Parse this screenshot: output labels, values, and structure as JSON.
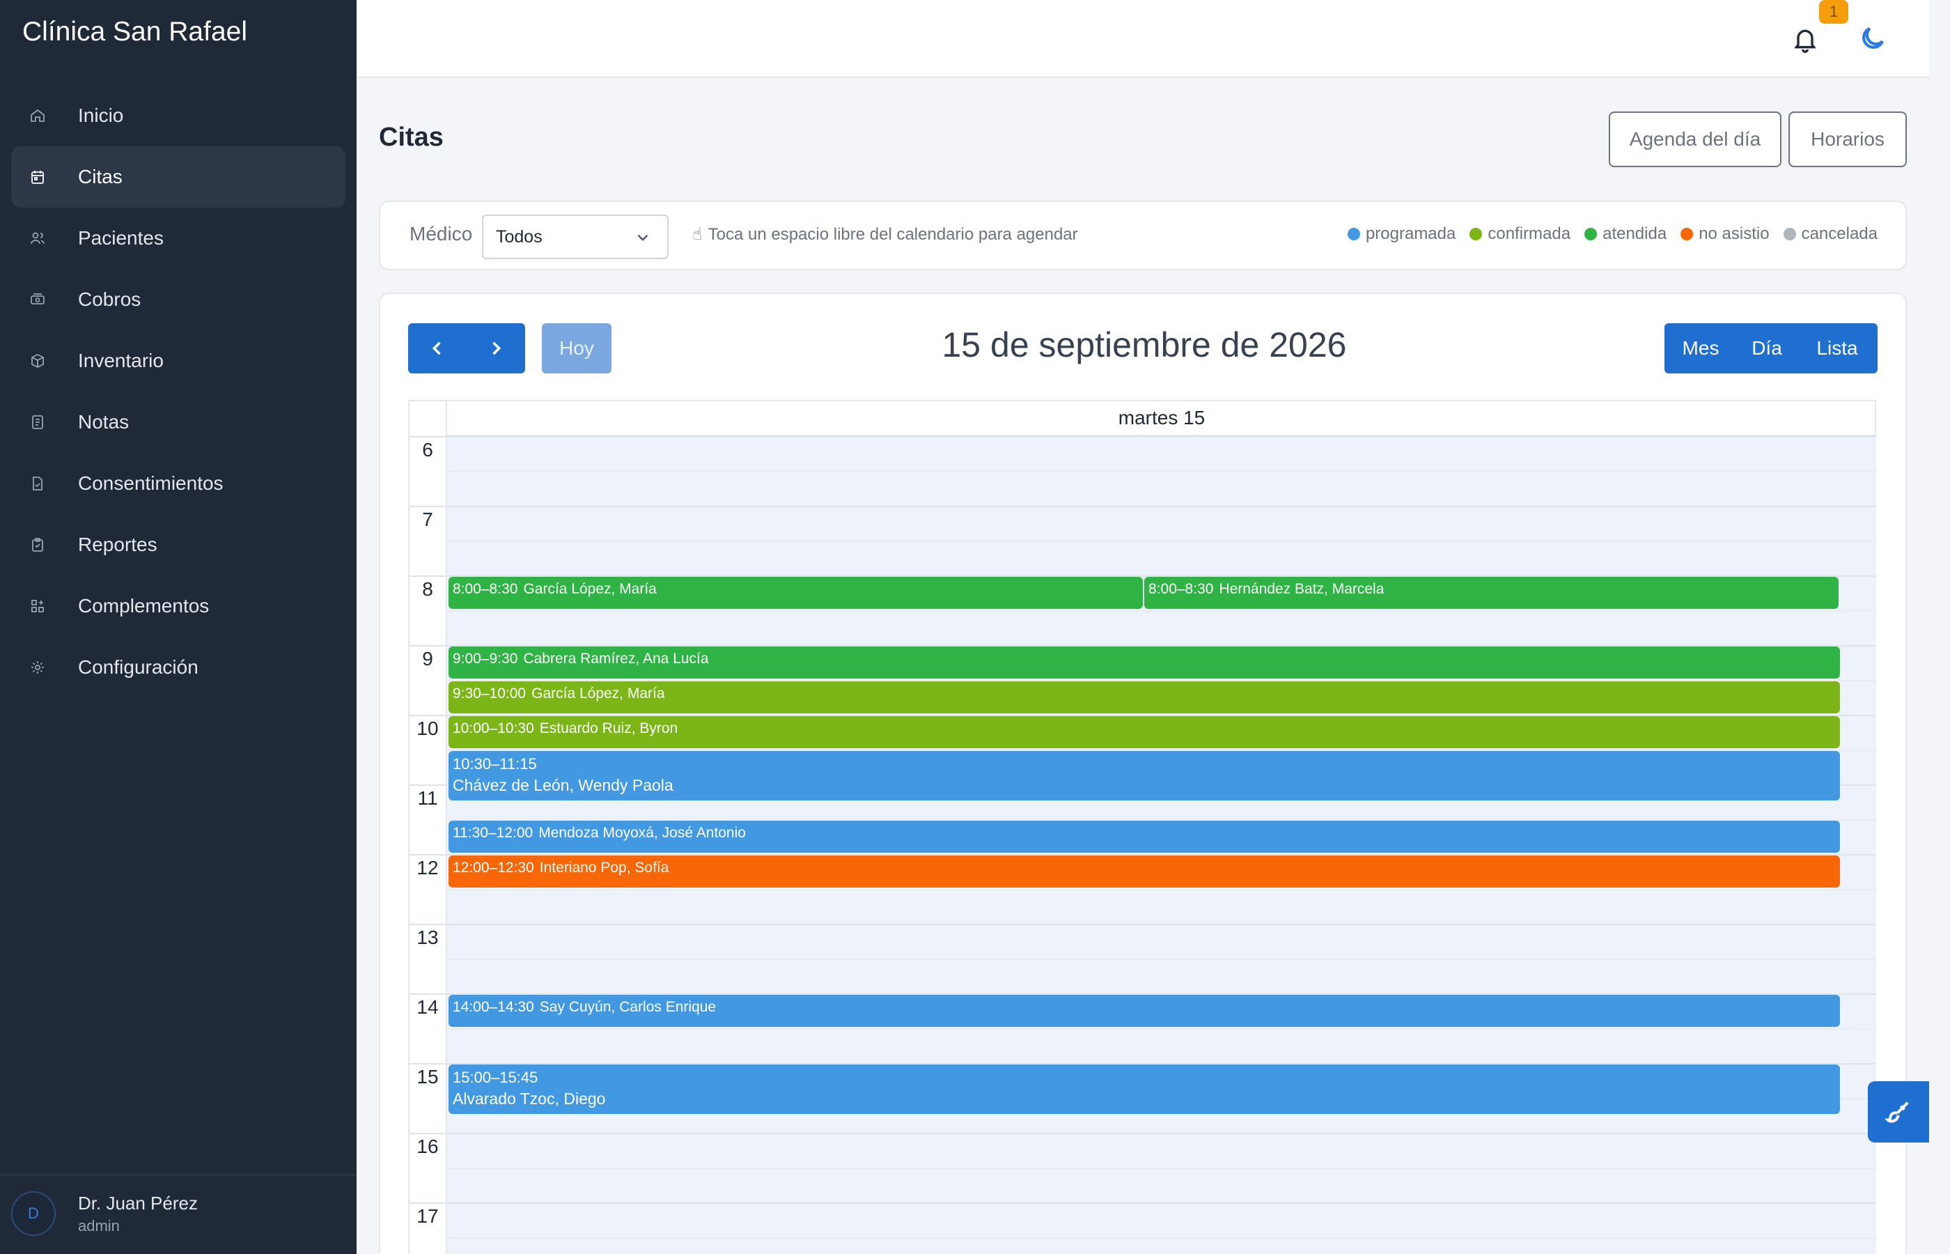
{
  "app": {
    "title": "Clínica San Rafael"
  },
  "sidebar": {
    "items": [
      {
        "label": "Inicio",
        "icon": "home-icon",
        "active": false
      },
      {
        "label": "Citas",
        "icon": "calendar-icon",
        "active": true
      },
      {
        "label": "Pacientes",
        "icon": "users-icon",
        "active": false
      },
      {
        "label": "Cobros",
        "icon": "cash-icon",
        "active": false
      },
      {
        "label": "Inventario",
        "icon": "box-icon",
        "active": false
      },
      {
        "label": "Notas",
        "icon": "note-icon",
        "active": false
      },
      {
        "label": "Consentimientos",
        "icon": "document-check-icon",
        "active": false
      },
      {
        "label": "Reportes",
        "icon": "clipboard-icon",
        "active": false
      },
      {
        "label": "Complementos",
        "icon": "apps-icon",
        "active": false
      },
      {
        "label": "Configuración",
        "icon": "gear-icon",
        "active": false
      }
    ],
    "user": {
      "initial": "D",
      "name": "Dr. Juan Pérez",
      "role": "admin"
    }
  },
  "topbar": {
    "notification_count": "1"
  },
  "page": {
    "title": "Citas",
    "agenda_button": "Agenda del día",
    "schedules_button": "Horarios"
  },
  "filter": {
    "doctor_label": "Médico",
    "doctor_value": "Todos",
    "hint": "Toca un espacio libre del calendario para agendar",
    "legend": [
      {
        "label": "programada",
        "color": "#4299e1"
      },
      {
        "label": "confirmada",
        "color": "#7cb518"
      },
      {
        "label": "atendida",
        "color": "#2fb344"
      },
      {
        "label": "no asistio",
        "color": "#f76707"
      },
      {
        "label": "cancelada",
        "color": "#adb5bd"
      }
    ]
  },
  "calendar": {
    "today_button": "Hoy",
    "title": "15 de septiembre de 2026",
    "views": [
      "Mes",
      "Día",
      "Lista"
    ],
    "day_header": "martes 15",
    "hours": [
      "6",
      "7",
      "8",
      "9",
      "10",
      "11",
      "12",
      "13",
      "14",
      "15",
      "16",
      "17"
    ],
    "events": [
      {
        "time": "8:00–8:30",
        "name": "García López, María",
        "start": 8.0,
        "end": 8.5,
        "status": "atendida",
        "col": 0,
        "cols": 2
      },
      {
        "time": "8:00–8:30",
        "name": "Hernández Batz, Marcela",
        "start": 8.0,
        "end": 8.5,
        "status": "atendida",
        "col": 1,
        "cols": 2
      },
      {
        "time": "9:00–9:30",
        "name": "Cabrera Ramírez, Ana Lucía",
        "start": 9.0,
        "end": 9.5,
        "status": "atendida",
        "col": 0,
        "cols": 1
      },
      {
        "time": "9:30–10:00",
        "name": "García López, María",
        "start": 9.5,
        "end": 10.0,
        "status": "confirmada",
        "col": 0,
        "cols": 1
      },
      {
        "time": "10:00–10:30",
        "name": "Estuardo Ruiz, Byron",
        "start": 10.0,
        "end": 10.5,
        "status": "confirmada",
        "col": 0,
        "cols": 1
      },
      {
        "time": "10:30–11:15",
        "name": "Chávez de León, Wendy Paola",
        "start": 10.5,
        "end": 11.25,
        "status": "programada",
        "col": 0,
        "cols": 1
      },
      {
        "time": "11:30–12:00",
        "name": "Mendoza Moyoxá, José Antonio",
        "start": 11.5,
        "end": 12.0,
        "status": "programada",
        "col": 0,
        "cols": 1
      },
      {
        "time": "12:00–12:30",
        "name": "Interiano Pop, Sofía",
        "start": 12.0,
        "end": 12.5,
        "status": "no asistio",
        "col": 0,
        "cols": 1
      },
      {
        "time": "14:00–14:30",
        "name": "Say Cuyún, Carlos Enrique",
        "start": 14.0,
        "end": 14.5,
        "status": "programada",
        "col": 0,
        "cols": 1
      },
      {
        "time": "15:00–15:45",
        "name": "Alvarado Tzoc, Diego",
        "start": 15.0,
        "end": 15.75,
        "status": "programada",
        "col": 0,
        "cols": 1
      }
    ]
  }
}
